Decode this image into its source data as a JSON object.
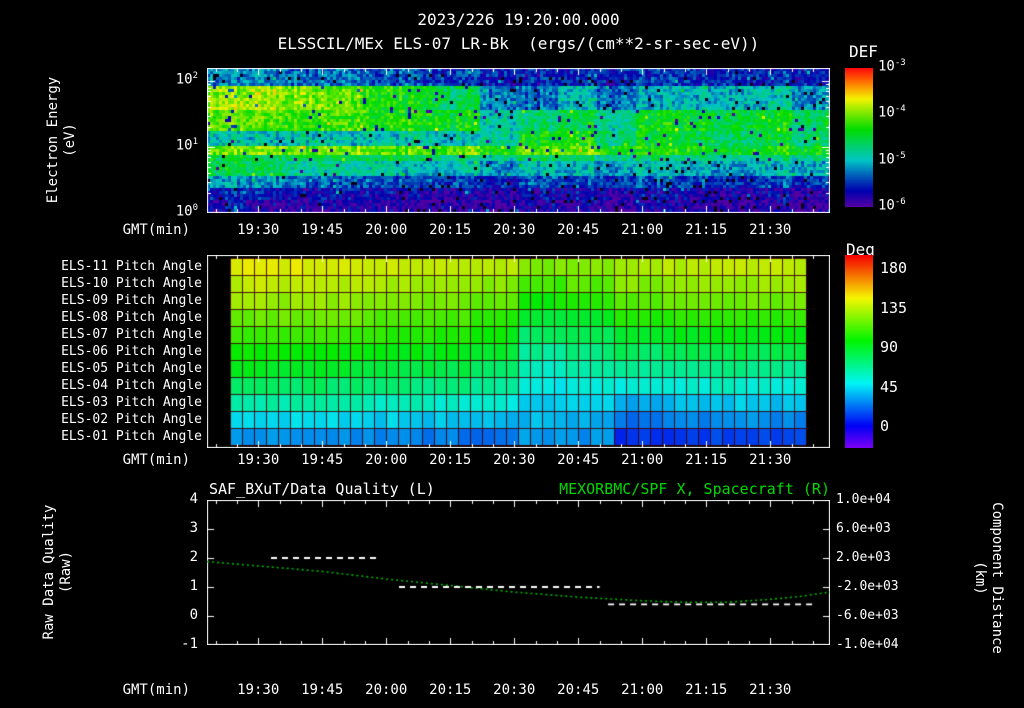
{
  "colors": {
    "background": "#000000",
    "text": "#ffffff",
    "right_title_green": "#00d800",
    "quality_trace_white": "#ffffff",
    "distance_trace_green": "#00b400"
  },
  "header": {
    "datetime_title": "2023/226 19:20:00.000",
    "instrument_title": "ELSSCIL/MEx ELS-07 LR-Bk  (ergs/(cm**2-sr-sec-eV))"
  },
  "time_axis": {
    "label": "GMT(min)",
    "start_min": 1158,
    "end_min": 1304,
    "ticks": [
      "19:30",
      "19:45",
      "20:00",
      "20:15",
      "20:30",
      "20:45",
      "21:00",
      "21:15",
      "21:30"
    ],
    "tick_minutes": [
      1170,
      1185,
      1200,
      1215,
      1230,
      1245,
      1260,
      1275,
      1290
    ]
  },
  "spectrogram_panel": {
    "ylabel_line1": "Electron Energy",
    "ylabel_line2": "(eV)",
    "yticks": [
      {
        "base": "10",
        "exp": "2",
        "log": 2
      },
      {
        "base": "10",
        "exp": "1",
        "log": 1
      },
      {
        "base": "10",
        "exp": "0",
        "log": 0
      }
    ],
    "colorbar_title": "DEF",
    "colorbar_ticks": [
      {
        "base": "10",
        "exp": "-3",
        "value": -3
      },
      {
        "base": "10",
        "exp": "-4",
        "value": -4
      },
      {
        "base": "10",
        "exp": "-5",
        "value": -5
      },
      {
        "base": "10",
        "exp": "-6",
        "value": -6
      }
    ]
  },
  "pitch_panel": {
    "row_labels": [
      "ELS-11 Pitch Angle",
      "ELS-10 Pitch Angle",
      "ELS-09 Pitch Angle",
      "ELS-08 Pitch Angle",
      "ELS-07 Pitch Angle",
      "ELS-06 Pitch Angle",
      "ELS-05 Pitch Angle",
      "ELS-04 Pitch Angle",
      "ELS-03 Pitch Angle",
      "ELS-02 Pitch Angle",
      "ELS-01 Pitch Angle"
    ],
    "colorbar_title": "Deg",
    "colorbar_ticks": [
      180,
      135,
      90,
      45,
      0
    ]
  },
  "bottom_panel": {
    "left_title": "SAF_BXuT/Data Quality (L)",
    "right_title": "MEXORBMC/SPF X, Spacecraft (R)",
    "left_ylabel_line1": "Raw Data Quality",
    "left_ylabel_line2": "(Raw)",
    "right_ylabel_line1": "Component Distance",
    "right_ylabel_line2": "(km)",
    "left_ticks": [
      4,
      3,
      2,
      1,
      0,
      -1
    ],
    "right_ticks": [
      "1.0e+04",
      "6.0e+03",
      "2.0e+03",
      "-2.0e+03",
      "-6.0e+03",
      "-1.0e+04"
    ],
    "left_range": [
      -1,
      4
    ],
    "right_range": [
      -10000,
      10000
    ]
  },
  "chart_data": [
    {
      "type": "heatmap",
      "name": "electron-energy-spectrogram",
      "title": "ELSSCIL/MEx ELS-07 LR-Bk",
      "value_units": "ergs/(cm**2-sr-sec-eV)",
      "x_start_gmt": "19:18",
      "x_end_gmt": "21:44",
      "n_time_cols": 16,
      "y_range_ev": [
        1,
        158
      ],
      "log10_flux_range": [
        -6,
        -3
      ],
      "bands": [
        {
          "e_ev": [
            90,
            158
          ],
          "log_flux": [
            -5.2,
            -5.2,
            -5.3,
            -5.3,
            -5.4,
            -5.4,
            -5.5,
            -5.6,
            -5.6,
            -5.5,
            -5.6,
            -5.5,
            -5.5,
            -5.5,
            -5.5,
            -5.6
          ]
        },
        {
          "e_ev": [
            40,
            90
          ],
          "log_flux": [
            -3.9,
            -3.9,
            -4.0,
            -4.1,
            -4.3,
            -4.4,
            -4.6,
            -5.2,
            -5.3,
            -5.0,
            -5.3,
            -5.1,
            -5.0,
            -5.0,
            -4.9,
            -5.2
          ]
        },
        {
          "e_ev": [
            18,
            40
          ],
          "log_flux": [
            -4.1,
            -4.1,
            -4.2,
            -4.2,
            -4.3,
            -4.3,
            -4.4,
            -4.9,
            -4.7,
            -4.5,
            -4.8,
            -4.4,
            -4.4,
            -4.5,
            -4.4,
            -4.6
          ]
        },
        {
          "e_ev": [
            11,
            18
          ],
          "log_flux": [
            -4.9,
            -5.0,
            -4.9,
            -5.0,
            -5.0,
            -4.9,
            -5.0,
            -4.8,
            -4.4,
            -4.3,
            -4.7,
            -4.5,
            -4.5,
            -4.6,
            -4.5,
            -4.7
          ]
        },
        {
          "e_ev": [
            8,
            11
          ],
          "log_flux": [
            -4.0,
            -4.0,
            -4.1,
            -4.0,
            -4.1,
            -4.1,
            -4.1,
            -4.3,
            -4.1,
            -4.0,
            -4.4,
            -4.3,
            -4.3,
            -4.4,
            -4.3,
            -4.4
          ]
        },
        {
          "e_ev": [
            6.3,
            8
          ],
          "log_flux": [
            -4.5,
            -4.6,
            -4.5,
            -4.6,
            -4.6,
            -4.6,
            -4.7,
            -4.8,
            -4.6,
            -4.6,
            -4.8,
            -4.7,
            -4.7,
            -4.8,
            -4.7,
            -4.8
          ]
        },
        {
          "e_ev": [
            4,
            6.3
          ],
          "log_flux": [
            -4.5,
            -4.6,
            -4.8,
            -4.9,
            -4.9,
            -5.0,
            -5.0,
            -5.2,
            -5.0,
            -5.0,
            -5.1,
            -5.0,
            -5.0,
            -5.1,
            -5.0,
            -5.1
          ]
        },
        {
          "e_ev": [
            2.5,
            4
          ],
          "log_flux": [
            -5.1,
            -5.2,
            -5.3,
            -5.4,
            -5.4,
            -5.4,
            -5.5,
            -5.6,
            -5.4,
            -5.4,
            -5.5,
            -5.4,
            -5.4,
            -5.5,
            -5.4,
            -5.5
          ]
        },
        {
          "e_ev": [
            1.6,
            2.5
          ],
          "log_flux": [
            -5.6,
            -5.6,
            -5.7,
            -5.7,
            -5.7,
            -5.7,
            -5.8,
            -5.8,
            -5.7,
            -5.7,
            -5.8,
            -5.7,
            -5.7,
            -5.8,
            -5.7,
            -5.8
          ]
        },
        {
          "e_ev": [
            1,
            1.6
          ],
          "log_flux": [
            -5.7,
            -5.8,
            -5.8,
            -5.8,
            -5.8,
            -5.9,
            -5.9,
            -5.9,
            -5.8,
            -5.8,
            -5.9,
            -5.8,
            -5.8,
            -5.9,
            -5.8,
            -5.9
          ]
        }
      ]
    },
    {
      "type": "heatmap",
      "name": "pitch-angle-grid",
      "value_units": "Deg",
      "x_start_gmt": "19:23",
      "x_end_gmt": "21:38",
      "n_time_blocks": 12,
      "value_range_deg": [
        0,
        180
      ],
      "rows": [
        {
          "label": "ELS-11",
          "deg": [
            138,
            138,
            136,
            134,
            132,
            130,
            120,
            122,
            128,
            130,
            132,
            132
          ]
        },
        {
          "label": "ELS-10",
          "deg": [
            132,
            131,
            130,
            128,
            126,
            123,
            111,
            114,
            122,
            124,
            126,
            126
          ]
        },
        {
          "label": "ELS-09",
          "deg": [
            126,
            125,
            124,
            122,
            120,
            115,
            101,
            105,
            114,
            116,
            118,
            118
          ]
        },
        {
          "label": "ELS-08",
          "deg": [
            118,
            117,
            116,
            114,
            112,
            107,
            91,
            95,
            104,
            106,
            108,
            108
          ]
        },
        {
          "label": "ELS-07",
          "deg": [
            110,
            109,
            108,
            106,
            104,
            99,
            83,
            87,
            94,
            96,
            98,
            97
          ]
        },
        {
          "label": "ELS-06",
          "deg": [
            102,
            101,
            100,
            98,
            96,
            91,
            75,
            79,
            84,
            86,
            88,
            87
          ]
        },
        {
          "label": "ELS-05",
          "deg": [
            94,
            93,
            92,
            90,
            88,
            83,
            67,
            71,
            73,
            75,
            77,
            76
          ]
        },
        {
          "label": "ELS-04",
          "deg": [
            84,
            83,
            82,
            80,
            78,
            74,
            61,
            63,
            62,
            64,
            66,
            65
          ]
        },
        {
          "label": "ELS-03",
          "deg": [
            72,
            71,
            70,
            68,
            66,
            64,
            56,
            57,
            50,
            52,
            54,
            53
          ]
        },
        {
          "label": "ELS-02",
          "deg": [
            58,
            57,
            56,
            55,
            54,
            52,
            51,
            50,
            40,
            42,
            44,
            43
          ]
        },
        {
          "label": "ELS-01",
          "deg": [
            44,
            44,
            43,
            42,
            41,
            40,
            46,
            45,
            28,
            30,
            32,
            31
          ]
        }
      ]
    },
    {
      "type": "line",
      "name": "quality-and-spacecraft-x",
      "left_axis": {
        "label": "Raw Data Quality (Raw)",
        "range": [
          -1,
          4
        ]
      },
      "right_axis": {
        "label": "Component Distance (km)",
        "range": [
          -10000,
          10000
        ]
      },
      "series": [
        {
          "name": "SAF_BXuT/Data Quality (L)",
          "axis": "left",
          "color": "#ffffff",
          "style": "dashed",
          "segments": [
            {
              "start_min": 1173,
              "end_min": 1198,
              "value": 2
            },
            {
              "start_min": 1203,
              "end_min": 1250,
              "value": 1
            },
            {
              "start_min": 1252,
              "end_min": 1300,
              "value": 0.4
            }
          ]
        },
        {
          "name": "MEXORBMC/SPF X, Spacecraft (R)",
          "axis": "right",
          "color": "#00b400",
          "style": "dotted",
          "points_min_km": [
            [
              1158,
              1500
            ],
            [
              1170,
              900
            ],
            [
              1185,
              150
            ],
            [
              1200,
              -900
            ],
            [
              1215,
              -1800
            ],
            [
              1230,
              -2700
            ],
            [
              1245,
              -3400
            ],
            [
              1260,
              -3900
            ],
            [
              1270,
              -4100
            ],
            [
              1280,
              -4100
            ],
            [
              1290,
              -3700
            ],
            [
              1297,
              -3300
            ],
            [
              1304,
              -2700
            ]
          ]
        }
      ]
    }
  ]
}
